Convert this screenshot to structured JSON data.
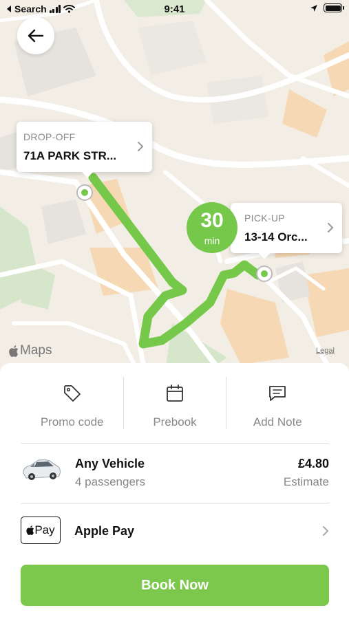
{
  "status_bar": {
    "back_app": "Search",
    "time": "9:41"
  },
  "map": {
    "dropoff": {
      "label": "DROP-OFF",
      "address": "71A PARK STR..."
    },
    "pickup": {
      "label": "PICK-UP",
      "address": "13-14 Orc..."
    },
    "eta": {
      "value": "30",
      "unit": "min"
    },
    "attribution": "Maps",
    "legal": "Legal",
    "route_color": "#76c84a"
  },
  "actions": [
    {
      "label": "Promo code",
      "icon": "tag-icon"
    },
    {
      "label": "Prebook",
      "icon": "calendar-icon"
    },
    {
      "label": "Add Note",
      "icon": "note-icon"
    }
  ],
  "vehicle": {
    "name": "Any Vehicle",
    "passengers": "4 passengers",
    "price": "£4.80",
    "price_note": "Estimate",
    "icon": "car-icon"
  },
  "payment": {
    "badge": "Pay",
    "method": "Apple Pay"
  },
  "book_button": "Book Now",
  "colors": {
    "accent": "#7cc84c"
  }
}
